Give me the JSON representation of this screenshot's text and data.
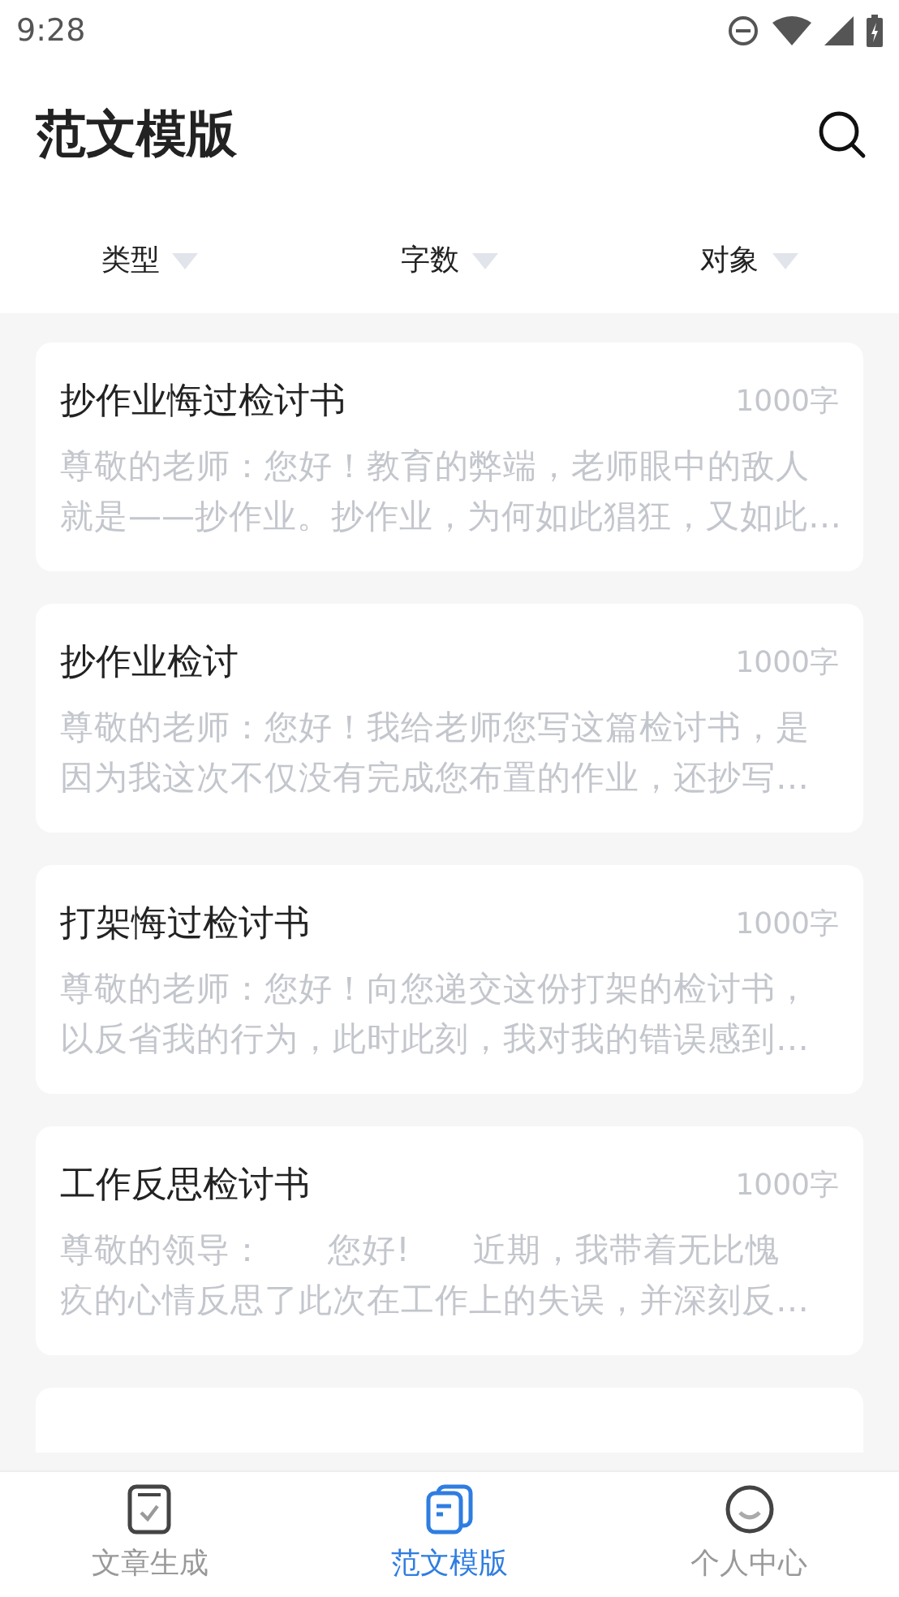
{
  "status_bar": {
    "time": "9:28"
  },
  "header": {
    "title": "范文模版"
  },
  "filters": [
    {
      "label": "类型"
    },
    {
      "label": "字数"
    },
    {
      "label": "对象"
    }
  ],
  "articles": [
    {
      "title": "抄作业悔过检讨书",
      "count": "1000字",
      "excerpt_lines": [
        "尊敬的老师：您好！教育的弊端，老师眼中的敌人",
        "就是——抄作业。抄作业，为何如此猖狂，又如此…"
      ]
    },
    {
      "title": "抄作业检讨",
      "count": "1000字",
      "excerpt_lines": [
        "尊敬的老师：您好！我给老师您写这篇检讨书，是",
        "因为我这次不仅没有完成您布置的作业，还抄写…"
      ]
    },
    {
      "title": "打架悔过检讨书",
      "count": "1000字",
      "excerpt_lines": [
        "尊敬的老师：您好！向您递交这份打架的检讨书，",
        "以反省我的行为，此时此刻，我对我的错误感到…"
      ]
    },
    {
      "title": "工作反思检讨书",
      "count": "1000字",
      "excerpt_lines": [
        "尊敬的领导：      您好!      近期，我带着无比愧",
        "疚的心情反思了此次在工作上的失误，并深刻反…"
      ]
    }
  ],
  "tab_bar": [
    {
      "label": "文章生成",
      "selected": false,
      "kind": "doc"
    },
    {
      "label": "范文模版",
      "selected": true,
      "kind": "copies"
    },
    {
      "label": "个人中心",
      "selected": false,
      "kind": "face"
    }
  ]
}
